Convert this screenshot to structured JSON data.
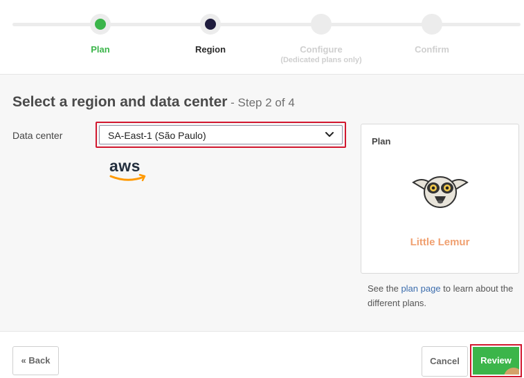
{
  "stepper": {
    "steps": [
      {
        "label": "Plan",
        "state": "complete",
        "color": "#3bb54a"
      },
      {
        "label": "Region",
        "state": "active",
        "color": "#1f1c3d"
      },
      {
        "label": "Configure",
        "sublabel": "(Dedicated plans only)",
        "state": "pending"
      },
      {
        "label": "Confirm",
        "state": "pending"
      }
    ]
  },
  "main": {
    "heading": "Select a region and data center",
    "step_note": " - Step 2 of 4",
    "data_center_label": "Data center",
    "data_center_value": "SA-East-1 (São Paulo)",
    "provider_logo": "aws"
  },
  "plan_card": {
    "title": "Plan",
    "mascot_icon": "lemur-icon",
    "plan_name": "Little Lemur",
    "help_prefix": "See the ",
    "help_link": "plan page",
    "help_suffix": " to learn about the different plans."
  },
  "footer": {
    "back_label": "« Back",
    "cancel_label": "Cancel",
    "review_label": "Review"
  },
  "colors": {
    "accent_green": "#3bb54a",
    "highlight_red": "#d1162e",
    "plan_orange": "#f0a070",
    "link_blue": "#3c6dad"
  }
}
